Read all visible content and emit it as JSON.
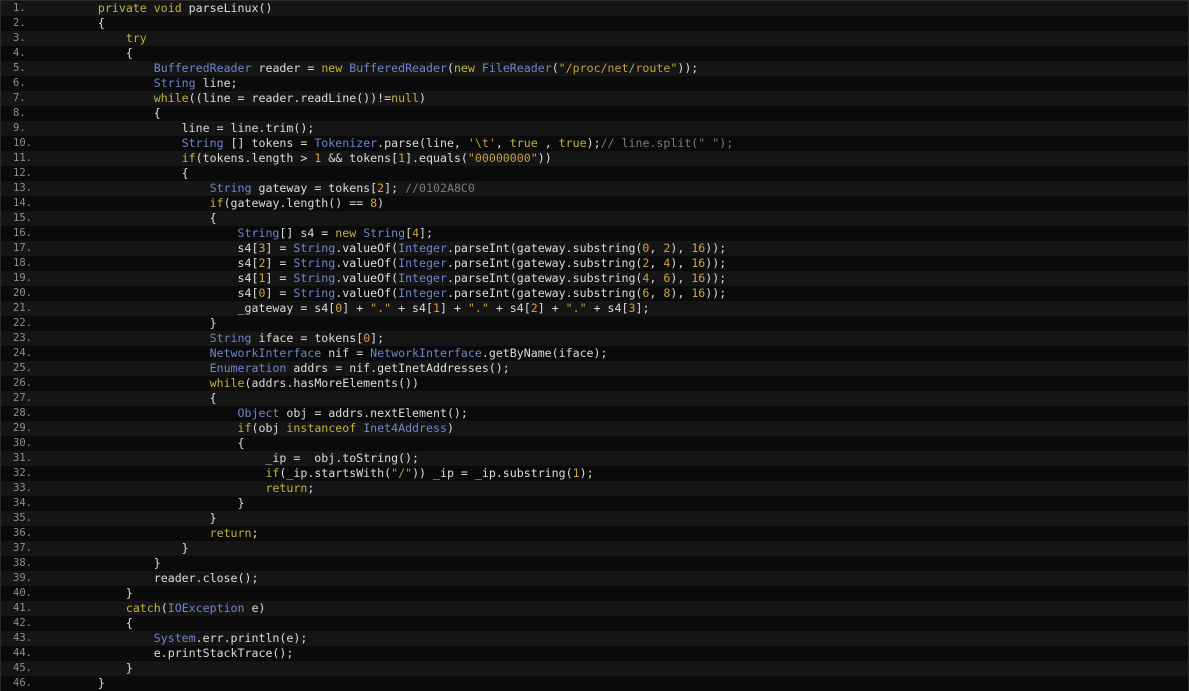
{
  "editor": {
    "colors": {
      "background": "#0b0b0b",
      "stripe_odd": "#151515",
      "stripe_even": "#0a0a0a",
      "line_number": "#8e8e8e",
      "plain": "#dcdcdc",
      "keyword": "#c3b23a",
      "type": "#6b86c9",
      "number": "#d1a03f",
      "string": "#c69f3e",
      "comment": "#7b7b7b"
    },
    "lines": [
      {
        "n": "1",
        "tokens": [
          [
            "txt",
            "    "
          ],
          [
            "kw",
            "private void "
          ],
          [
            "txt",
            "parseLinux()"
          ]
        ]
      },
      {
        "n": "2",
        "tokens": [
          [
            "txt",
            "    {"
          ]
        ]
      },
      {
        "n": "3",
        "tokens": [
          [
            "txt",
            "        "
          ],
          [
            "kw",
            "try"
          ]
        ]
      },
      {
        "n": "4",
        "tokens": [
          [
            "txt",
            "        {"
          ]
        ]
      },
      {
        "n": "5",
        "tokens": [
          [
            "txt",
            "            "
          ],
          [
            "type",
            "BufferedReader"
          ],
          [
            "txt",
            " reader = "
          ],
          [
            "kw",
            "new "
          ],
          [
            "type",
            "BufferedReader"
          ],
          [
            "txt",
            "("
          ],
          [
            "kw",
            "new "
          ],
          [
            "type",
            "FileReader"
          ],
          [
            "txt",
            "("
          ],
          [
            "str",
            "\"/proc/net/route\""
          ],
          [
            "txt",
            "));"
          ]
        ]
      },
      {
        "n": "6",
        "tokens": [
          [
            "txt",
            "            "
          ],
          [
            "type",
            "String"
          ],
          [
            "txt",
            " line;"
          ]
        ]
      },
      {
        "n": "7",
        "tokens": [
          [
            "txt",
            "            "
          ],
          [
            "kw",
            "while"
          ],
          [
            "txt",
            "((line = reader.readLine())!="
          ],
          [
            "kw",
            "null"
          ],
          [
            "txt",
            ")"
          ]
        ]
      },
      {
        "n": "8",
        "tokens": [
          [
            "txt",
            "            {"
          ]
        ]
      },
      {
        "n": "9",
        "tokens": [
          [
            "txt",
            "                line = line.trim();"
          ]
        ]
      },
      {
        "n": "10",
        "tokens": [
          [
            "txt",
            "                "
          ],
          [
            "type",
            "String"
          ],
          [
            "txt",
            " [] tokens = "
          ],
          [
            "type",
            "Tokenizer"
          ],
          [
            "txt",
            ".parse(line, "
          ],
          [
            "str",
            "'\\t'"
          ],
          [
            "txt",
            ", "
          ],
          [
            "kw",
            "true"
          ],
          [
            "txt",
            " , "
          ],
          [
            "kw",
            "true"
          ],
          [
            "txt",
            ");"
          ],
          [
            "com",
            "// line.split(\" \");"
          ]
        ]
      },
      {
        "n": "11",
        "tokens": [
          [
            "txt",
            "                "
          ],
          [
            "kw",
            "if"
          ],
          [
            "txt",
            "(tokens.length > "
          ],
          [
            "num",
            "1"
          ],
          [
            "txt",
            " && tokens["
          ],
          [
            "num",
            "1"
          ],
          [
            "txt",
            "].equals("
          ],
          [
            "str",
            "\"00000000\""
          ],
          [
            "txt",
            "))"
          ]
        ]
      },
      {
        "n": "12",
        "tokens": [
          [
            "txt",
            "                {"
          ]
        ]
      },
      {
        "n": "13",
        "tokens": [
          [
            "txt",
            "                    "
          ],
          [
            "type",
            "String"
          ],
          [
            "txt",
            " gateway = tokens["
          ],
          [
            "num",
            "2"
          ],
          [
            "txt",
            "]; "
          ],
          [
            "com",
            "//0102A8C0"
          ]
        ]
      },
      {
        "n": "14",
        "tokens": [
          [
            "txt",
            "                    "
          ],
          [
            "kw",
            "if"
          ],
          [
            "txt",
            "(gateway.length() == "
          ],
          [
            "num",
            "8"
          ],
          [
            "txt",
            ")"
          ]
        ]
      },
      {
        "n": "15",
        "tokens": [
          [
            "txt",
            "                    {"
          ]
        ]
      },
      {
        "n": "16",
        "tokens": [
          [
            "txt",
            "                        "
          ],
          [
            "type",
            "String"
          ],
          [
            "txt",
            "[] s4 = "
          ],
          [
            "kw",
            "new "
          ],
          [
            "type",
            "String"
          ],
          [
            "txt",
            "["
          ],
          [
            "num",
            "4"
          ],
          [
            "txt",
            "];"
          ]
        ]
      },
      {
        "n": "17",
        "tokens": [
          [
            "txt",
            "                        s4["
          ],
          [
            "num",
            "3"
          ],
          [
            "txt",
            "] = "
          ],
          [
            "type",
            "String"
          ],
          [
            "txt",
            ".valueOf("
          ],
          [
            "type",
            "Integer"
          ],
          [
            "txt",
            ".parseInt(gateway.substring("
          ],
          [
            "num",
            "0"
          ],
          [
            "txt",
            ", "
          ],
          [
            "num",
            "2"
          ],
          [
            "txt",
            "), "
          ],
          [
            "num",
            "16"
          ],
          [
            "txt",
            "));"
          ]
        ]
      },
      {
        "n": "18",
        "tokens": [
          [
            "txt",
            "                        s4["
          ],
          [
            "num",
            "2"
          ],
          [
            "txt",
            "] = "
          ],
          [
            "type",
            "String"
          ],
          [
            "txt",
            ".valueOf("
          ],
          [
            "type",
            "Integer"
          ],
          [
            "txt",
            ".parseInt(gateway.substring("
          ],
          [
            "num",
            "2"
          ],
          [
            "txt",
            ", "
          ],
          [
            "num",
            "4"
          ],
          [
            "txt",
            "), "
          ],
          [
            "num",
            "16"
          ],
          [
            "txt",
            "));"
          ]
        ]
      },
      {
        "n": "19",
        "tokens": [
          [
            "txt",
            "                        s4["
          ],
          [
            "num",
            "1"
          ],
          [
            "txt",
            "] = "
          ],
          [
            "type",
            "String"
          ],
          [
            "txt",
            ".valueOf("
          ],
          [
            "type",
            "Integer"
          ],
          [
            "txt",
            ".parseInt(gateway.substring("
          ],
          [
            "num",
            "4"
          ],
          [
            "txt",
            ", "
          ],
          [
            "num",
            "6"
          ],
          [
            "txt",
            "), "
          ],
          [
            "num",
            "16"
          ],
          [
            "txt",
            "));"
          ]
        ]
      },
      {
        "n": "20",
        "tokens": [
          [
            "txt",
            "                        s4["
          ],
          [
            "num",
            "0"
          ],
          [
            "txt",
            "] = "
          ],
          [
            "type",
            "String"
          ],
          [
            "txt",
            ".valueOf("
          ],
          [
            "type",
            "Integer"
          ],
          [
            "txt",
            ".parseInt(gateway.substring("
          ],
          [
            "num",
            "6"
          ],
          [
            "txt",
            ", "
          ],
          [
            "num",
            "8"
          ],
          [
            "txt",
            "), "
          ],
          [
            "num",
            "16"
          ],
          [
            "txt",
            "));"
          ]
        ]
      },
      {
        "n": "21",
        "tokens": [
          [
            "txt",
            "                        _gateway = s4["
          ],
          [
            "num",
            "0"
          ],
          [
            "txt",
            "] + "
          ],
          [
            "str",
            "\".\""
          ],
          [
            "txt",
            " + s4["
          ],
          [
            "num",
            "1"
          ],
          [
            "txt",
            "] + "
          ],
          [
            "str",
            "\".\""
          ],
          [
            "txt",
            " + s4["
          ],
          [
            "num",
            "2"
          ],
          [
            "txt",
            "] + "
          ],
          [
            "str",
            "\".\""
          ],
          [
            "txt",
            " + s4["
          ],
          [
            "num",
            "3"
          ],
          [
            "txt",
            "];"
          ]
        ]
      },
      {
        "n": "22",
        "tokens": [
          [
            "txt",
            "                    }"
          ]
        ]
      },
      {
        "n": "23",
        "tokens": [
          [
            "txt",
            "                    "
          ],
          [
            "type",
            "String"
          ],
          [
            "txt",
            " iface = tokens["
          ],
          [
            "num",
            "0"
          ],
          [
            "txt",
            "];"
          ]
        ]
      },
      {
        "n": "24",
        "tokens": [
          [
            "txt",
            "                    "
          ],
          [
            "type",
            "NetworkInterface"
          ],
          [
            "txt",
            " nif = "
          ],
          [
            "type",
            "NetworkInterface"
          ],
          [
            "txt",
            ".getByName(iface);"
          ]
        ]
      },
      {
        "n": "25",
        "tokens": [
          [
            "txt",
            "                    "
          ],
          [
            "type",
            "Enumeration"
          ],
          [
            "txt",
            " addrs = nif.getInetAddresses();"
          ]
        ]
      },
      {
        "n": "26",
        "tokens": [
          [
            "txt",
            "                    "
          ],
          [
            "kw",
            "while"
          ],
          [
            "txt",
            "(addrs.hasMoreElements())"
          ]
        ]
      },
      {
        "n": "27",
        "tokens": [
          [
            "txt",
            "                    {"
          ]
        ]
      },
      {
        "n": "28",
        "tokens": [
          [
            "txt",
            "                        "
          ],
          [
            "type",
            "Object"
          ],
          [
            "txt",
            " obj = addrs.nextElement();"
          ]
        ]
      },
      {
        "n": "29",
        "tokens": [
          [
            "txt",
            "                        "
          ],
          [
            "kw",
            "if"
          ],
          [
            "txt",
            "(obj "
          ],
          [
            "kw",
            "instanceof "
          ],
          [
            "type",
            "Inet4Address"
          ],
          [
            "txt",
            ")"
          ]
        ]
      },
      {
        "n": "30",
        "tokens": [
          [
            "txt",
            "                        {"
          ]
        ]
      },
      {
        "n": "31",
        "tokens": [
          [
            "txt",
            "                            _ip =  obj.toString();"
          ]
        ]
      },
      {
        "n": "32",
        "tokens": [
          [
            "txt",
            "                            "
          ],
          [
            "kw",
            "if"
          ],
          [
            "txt",
            "(_ip.startsWith("
          ],
          [
            "str",
            "\"/\""
          ],
          [
            "txt",
            ")) _ip = _ip.substring("
          ],
          [
            "num",
            "1"
          ],
          [
            "txt",
            ");"
          ]
        ]
      },
      {
        "n": "33",
        "tokens": [
          [
            "txt",
            "                            "
          ],
          [
            "kw",
            "return"
          ],
          [
            "txt",
            ";"
          ]
        ]
      },
      {
        "n": "34",
        "tokens": [
          [
            "txt",
            "                        }"
          ]
        ]
      },
      {
        "n": "35",
        "tokens": [
          [
            "txt",
            "                    }"
          ]
        ]
      },
      {
        "n": "36",
        "tokens": [
          [
            "txt",
            "                    "
          ],
          [
            "kw",
            "return"
          ],
          [
            "txt",
            ";"
          ]
        ]
      },
      {
        "n": "37",
        "tokens": [
          [
            "txt",
            "                }"
          ]
        ]
      },
      {
        "n": "38",
        "tokens": [
          [
            "txt",
            "            }"
          ]
        ]
      },
      {
        "n": "39",
        "tokens": [
          [
            "txt",
            "            reader.close();"
          ]
        ]
      },
      {
        "n": "40",
        "tokens": [
          [
            "txt",
            "        }"
          ]
        ]
      },
      {
        "n": "41",
        "tokens": [
          [
            "txt",
            "        "
          ],
          [
            "kw",
            "catch"
          ],
          [
            "txt",
            "("
          ],
          [
            "type",
            "IOException"
          ],
          [
            "txt",
            " e)"
          ]
        ]
      },
      {
        "n": "42",
        "tokens": [
          [
            "txt",
            "        {"
          ]
        ]
      },
      {
        "n": "43",
        "tokens": [
          [
            "txt",
            "            "
          ],
          [
            "type",
            "System"
          ],
          [
            "txt",
            ".err.println(e);"
          ]
        ]
      },
      {
        "n": "44",
        "tokens": [
          [
            "txt",
            "            e.printStackTrace();"
          ]
        ]
      },
      {
        "n": "45",
        "tokens": [
          [
            "txt",
            "        }"
          ]
        ]
      },
      {
        "n": "46",
        "tokens": [
          [
            "txt",
            "    }"
          ]
        ]
      }
    ]
  }
}
